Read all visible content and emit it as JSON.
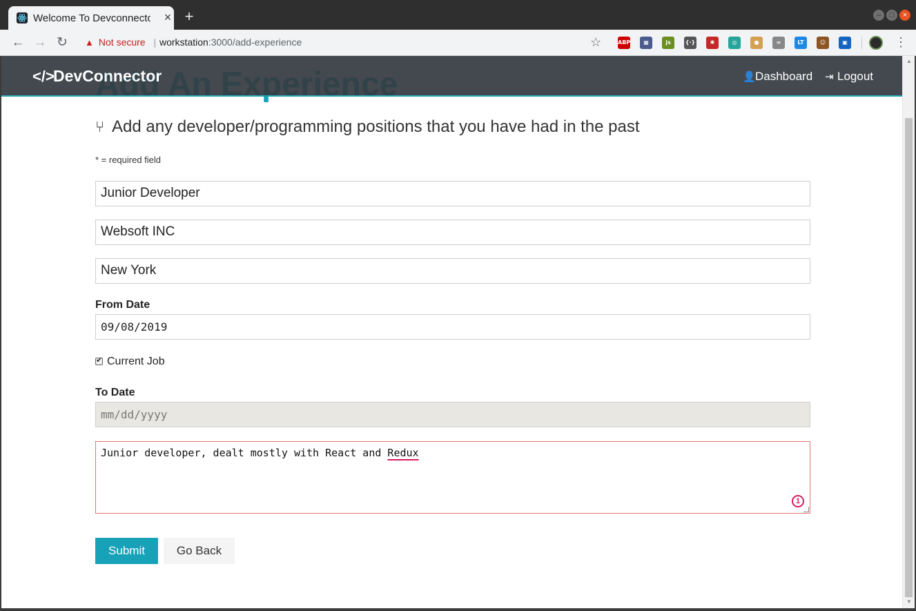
{
  "browser": {
    "tab_title": "Welcome To Devconnector",
    "tab_close": "×",
    "new_tab": "+",
    "security_label": "Not secure",
    "url_host": "workstation",
    "url_rest": ":3000/add-experience",
    "extensions": [
      {
        "name": "adblock-icon",
        "label": "ABP",
        "color": "#c00"
      },
      {
        "name": "extension-grid-icon",
        "label": "▦",
        "color": "#4a5b8c"
      },
      {
        "name": "js-extension-icon",
        "label": "js",
        "color": "#6b8e23"
      },
      {
        "name": "code-extension-icon",
        "label": "{·}",
        "color": "#555"
      },
      {
        "name": "puzzle-extension-icon",
        "label": "✱",
        "color": "#c62828"
      },
      {
        "name": "circle-extension-icon",
        "label": "◎",
        "color": "#26a69a"
      },
      {
        "name": "cookie-extension-icon",
        "label": "●",
        "color": "#d4a054"
      },
      {
        "name": "link-extension-icon",
        "label": "∞",
        "color": "#888"
      },
      {
        "name": "lt-extension-icon",
        "label": "LT",
        "color": "#1e88e5"
      },
      {
        "name": "monkey-extension-icon",
        "label": "☺",
        "color": "#8d5524"
      },
      {
        "name": "save-extension-icon",
        "label": "▣",
        "color": "#1565c0"
      }
    ]
  },
  "navbar": {
    "brand": "DevConnector",
    "links": {
      "dashboard": "Dashboard",
      "logout": "Logout"
    }
  },
  "page": {
    "heading": "Add An Experience",
    "lead": "Add any developer/programming positions that you have had in the past",
    "required_note": "* = required field"
  },
  "form": {
    "title_value": "Junior Developer",
    "company_value": "Websoft INC",
    "location_value": "New York",
    "from_label": "From Date",
    "from_value": "09/08/2019",
    "current_label": "Current Job",
    "current_checked": true,
    "to_label": "To Date",
    "to_placeholder": "mm/dd/yyyy",
    "description_before": "Junior developer, dealt mostly with React and ",
    "description_flagged": "Redux",
    "grammarly_count": "1",
    "submit_label": "Submit",
    "back_label": "Go Back"
  }
}
